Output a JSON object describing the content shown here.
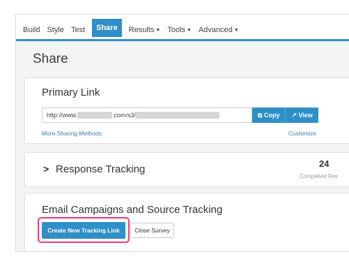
{
  "nav": {
    "items": [
      {
        "label": "Build"
      },
      {
        "label": "Style"
      },
      {
        "label": "Test"
      },
      {
        "label": "Share"
      },
      {
        "label": "Results"
      },
      {
        "label": "Tools"
      },
      {
        "label": "Advanced"
      }
    ],
    "active": "Share"
  },
  "page": {
    "title": "Share"
  },
  "primary_link": {
    "title": "Primary Link",
    "url_prefix": "http://www.",
    "url_middle": ".com/s3/",
    "copy_label": "Copy",
    "view_label": "View",
    "more_methods": "More Sharing Methods",
    "customize": "Customize"
  },
  "response_tracking": {
    "title": "Response Tracking",
    "count": "24",
    "count_label": "Completed Res"
  },
  "email_campaigns": {
    "title": "Email Campaigns and Source Tracking",
    "create_button": "Create New Tracking Link",
    "close_button": "Close Survey"
  },
  "colors": {
    "accent": "#2f8fc7",
    "highlight": "#e83c7a"
  }
}
